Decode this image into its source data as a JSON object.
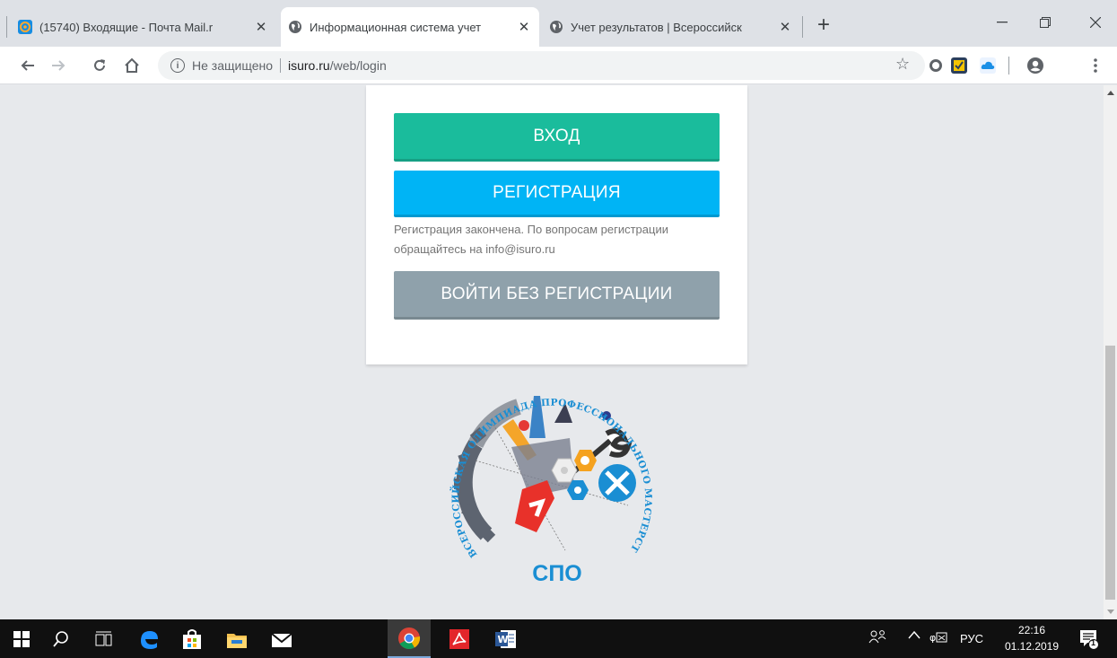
{
  "browser": {
    "tabs": [
      {
        "title": "(15740) Входящие - Почта Mail.r",
        "active": false,
        "favicon": "mail-icon"
      },
      {
        "title": "Информационная система учет",
        "active": true,
        "favicon": "globe-icon"
      },
      {
        "title": "Учет результатов | Всероссийск",
        "active": false,
        "favicon": "globe-icon"
      }
    ],
    "address": {
      "security_label": "Не защищено",
      "host": "isuro.ru",
      "path": "/web/login"
    }
  },
  "page": {
    "login_label": "ВХОД",
    "register_label": "РЕГИСТРАЦИЯ",
    "registration_note": "Регистрация закончена. По вопросам регистрации обращайтесь на info@isuro.ru",
    "guest_label": "ВОЙТИ БЕЗ РЕГИСТРАЦИИ",
    "logo": {
      "ring_text": "ВСЕРОССИЙСКАЯ ОЛИМПИАДА ПРОФЕССИОНАЛЬНОГО МАСТЕРСТВА",
      "caption": "СПО"
    }
  },
  "taskbar": {
    "lang": "РУС",
    "time": "22:16",
    "date": "01.12.2019",
    "notifications": "1"
  },
  "colors": {
    "login": "#1abc9c",
    "register": "#00b4f5",
    "guest": "#8fa1ab",
    "logo_blue": "#1a8ed3"
  }
}
